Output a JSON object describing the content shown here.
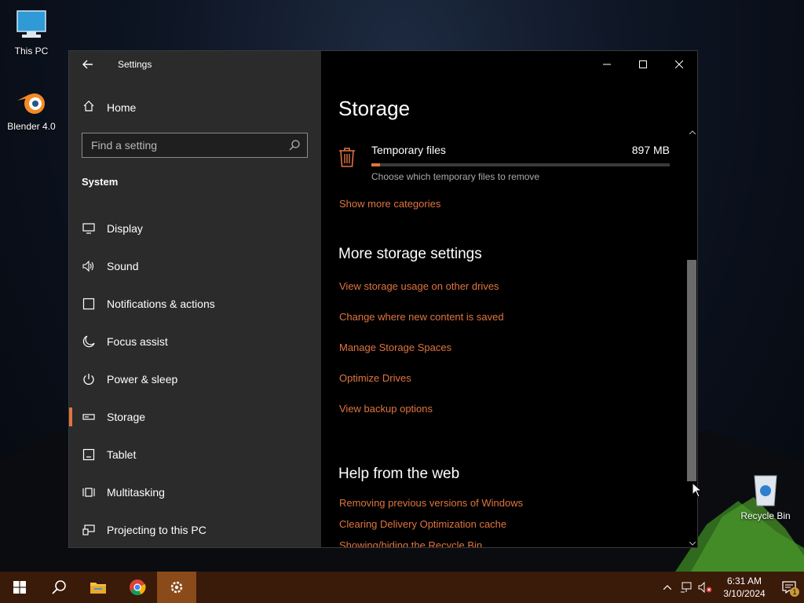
{
  "desktop": {
    "icons": [
      {
        "label": "This PC"
      },
      {
        "label": "Blender 4.0"
      },
      {
        "label": "Recycle Bin"
      }
    ]
  },
  "window": {
    "title": "Settings",
    "controls": {
      "minimize": "minimize-icon",
      "maximize": "maximize-icon",
      "close": "close-icon"
    }
  },
  "sidebar": {
    "home_label": "Home",
    "search_placeholder": "Find a setting",
    "section": "System",
    "items": [
      {
        "label": "Display",
        "icon": "display-icon"
      },
      {
        "label": "Sound",
        "icon": "sound-icon"
      },
      {
        "label": "Notifications & actions",
        "icon": "notifications-icon"
      },
      {
        "label": "Focus assist",
        "icon": "moon-icon"
      },
      {
        "label": "Power & sleep",
        "icon": "power-icon"
      },
      {
        "label": "Storage",
        "icon": "storage-icon",
        "active": true
      },
      {
        "label": "Tablet",
        "icon": "tablet-icon"
      },
      {
        "label": "Multitasking",
        "icon": "multitasking-icon"
      },
      {
        "label": "Projecting to this PC",
        "icon": "projecting-icon"
      }
    ]
  },
  "main": {
    "title": "Storage",
    "temp_files": {
      "name": "Temporary files",
      "size": "897 MB",
      "description": "Choose which temporary files to remove",
      "usage_fraction": 0.03
    },
    "show_more": "Show more categories",
    "more_settings": {
      "heading": "More storage settings",
      "links": [
        "View storage usage on other drives",
        "Change where new content is saved",
        "Manage Storage Spaces",
        "Optimize Drives",
        "View backup options"
      ]
    },
    "help": {
      "heading": "Help from the web",
      "links": [
        "Removing previous versions of Windows",
        "Clearing Delivery Optimization cache",
        "Showing/hiding the Recycle Bin"
      ]
    }
  },
  "taskbar": {
    "time": "6:31 AM",
    "date": "3/10/2024",
    "notification_count": "1"
  },
  "colors": {
    "accent": "#e0743f",
    "sidebar_bg": "#2b2b2b",
    "content_bg": "#000000",
    "taskbar_bg": "#3a1a08"
  }
}
